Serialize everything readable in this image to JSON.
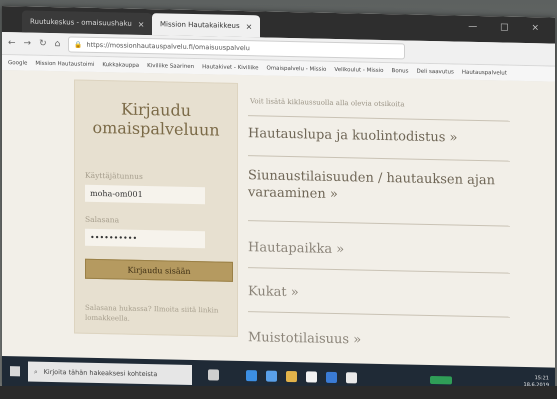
{
  "browser": {
    "tabs": [
      {
        "label": "Ruutukeskus - omaisuushaku"
      },
      {
        "label": "Mission Hautakaikkeus"
      }
    ],
    "url": "https://mossionhautauspalvelu.fi/omaisuuspalvelu",
    "bookmarks": [
      "Google",
      "Mission Hautaustoimi",
      "Kukkakauppa",
      "Kiviliike Saarinen",
      "Hautakivet - Kiviliike",
      "Omaispalvelu - Missio",
      "Velikoulut - Missio",
      "Bonus",
      "Deli saavutus",
      "Hautauspalvelut"
    ]
  },
  "login": {
    "title": "Kirjaudu omaispalveluun",
    "username_label": "Käyttäjätunnus",
    "username_value": "moha-om001",
    "password_label": "Salasana",
    "password_value": "••••••••••",
    "submit_label": "Kirjaudu sisään",
    "forgot_text": "Salasana hukassa? Ilmoita siitä linkin lomakkeella."
  },
  "content": {
    "intro": "Voit lisätä kiklaussuolla alla olevia otsikoita",
    "items": [
      "Hautauslupa ja kuolintodistus »",
      "Siunaustilaisuuden / hautauksen ajan varaaminen »",
      "Hautapaikka »",
      "Kukat »",
      "Muistotilaisuus »"
    ]
  },
  "taskbar": {
    "search_placeholder": "Kirjoita tähän hakeaksesi kohteista",
    "time": "15:21",
    "date": "18.6.2019"
  }
}
